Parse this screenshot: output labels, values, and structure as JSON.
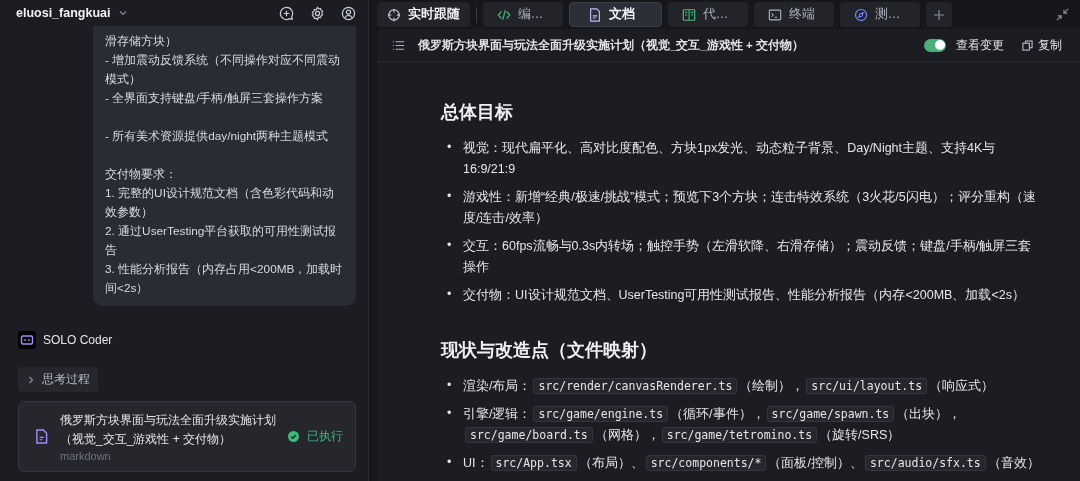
{
  "sidebar": {
    "project": "eluosi_fangkuai",
    "message_blocks": [
      [
        "滑存储方块）",
        "- 增加震动反馈系统（不同操作对应不同震动模式）",
        "- 全界面支持键盘/手柄/触屏三套操作方案"
      ],
      [
        "- 所有美术资源提供day/night两种主题模式"
      ],
      [
        "交付物要求：",
        "1. 完整的UI设计规范文档（含色彩代码和动效参数）",
        "2. 通过UserTesting平台获取的可用性测试报告",
        "3. 性能分析报告（内存占用<200MB，加载时间<2s）"
      ]
    ],
    "agent": "SOLO Coder",
    "thinking": {
      "label": "思考过程",
      "expanded": false
    },
    "artifact": {
      "title": "俄罗斯方块界面与玩法全面升级实施计划（视觉_交互_游戏性 + 交付物）",
      "type": "markdown",
      "status": "已执行"
    }
  },
  "tabs": [
    {
      "label": "实时跟随",
      "kind": "crosshair",
      "selected": false
    },
    {
      "label": "编...",
      "kind": "code",
      "selected": false
    },
    {
      "label": "文档",
      "kind": "doc",
      "selected": true
    },
    {
      "label": "代...",
      "kind": "book",
      "selected": false
    },
    {
      "label": "终端",
      "kind": "terminal",
      "selected": false
    },
    {
      "label": "测...",
      "kind": "compass",
      "selected": false
    }
  ],
  "document": {
    "title": "俄罗斯方块界面与玩法全面升级实施计划（视觉_交互_游戏性 + 交付物）",
    "show_changes": {
      "label": "查看变更",
      "on": true
    },
    "copy_label": "复制",
    "bullet": "•",
    "sections": [
      {
        "heading": "总体目标",
        "items": [
          [
            {
              "kind": "text",
              "text": "视觉：现代扁平化、高对比度配色、方块1px发光、动态粒子背景、Day/Night主题、支持4K与16:9/21:9"
            }
          ],
          [
            {
              "kind": "text",
              "text": "游戏性：新增“经典/极速/挑战”模式；预览下3个方块；连击特效系统（3火花/5闪电）；评分重构（速度/连击/效率）"
            }
          ],
          [
            {
              "kind": "text",
              "text": "交互：60fps流畅与0.3s内转场；触控手势（左滑软降、右滑存储）；震动反馈；键盘/手柄/触屏三套操作"
            }
          ],
          [
            {
              "kind": "text",
              "text": "交付物：UI设计规范文档、UserTesting可用性测试报告、性能分析报告（内存<200MB、加载<2s）"
            }
          ]
        ]
      },
      {
        "heading": "现状与改造点（文件映射）",
        "items": [
          [
            {
              "kind": "text",
              "text": "渲染/布局："
            },
            {
              "kind": "code",
              "text": "src/render/canvasRenderer.ts"
            },
            {
              "kind": "text",
              "text": "（绘制），"
            },
            {
              "kind": "code",
              "text": "src/ui/layout.ts"
            },
            {
              "kind": "text",
              "text": "（响应式）"
            }
          ],
          [
            {
              "kind": "text",
              "text": "引擎/逻辑："
            },
            {
              "kind": "code",
              "text": "src/game/engine.ts"
            },
            {
              "kind": "text",
              "text": "（循环/事件），"
            },
            {
              "kind": "code",
              "text": "src/game/spawn.ts"
            },
            {
              "kind": "text",
              "text": "（出块），"
            },
            {
              "kind": "code",
              "text": "src/game/board.ts"
            },
            {
              "kind": "text",
              "text": "（网格），"
            },
            {
              "kind": "code",
              "text": "src/game/tetromino.ts"
            },
            {
              "kind": "text",
              "text": "（旋转/SRS）"
            }
          ],
          [
            {
              "kind": "text",
              "text": "UI："
            },
            {
              "kind": "code",
              "text": "src/App.tsx"
            },
            {
              "kind": "text",
              "text": "（布局）、"
            },
            {
              "kind": "code",
              "text": "src/components/*"
            },
            {
              "kind": "text",
              "text": "（面板/控制）、"
            },
            {
              "kind": "code",
              "text": "src/audio/sfx.ts"
            },
            {
              "kind": "text",
              "text": "（音效）"
            }
          ]
        ]
      }
    ]
  }
}
